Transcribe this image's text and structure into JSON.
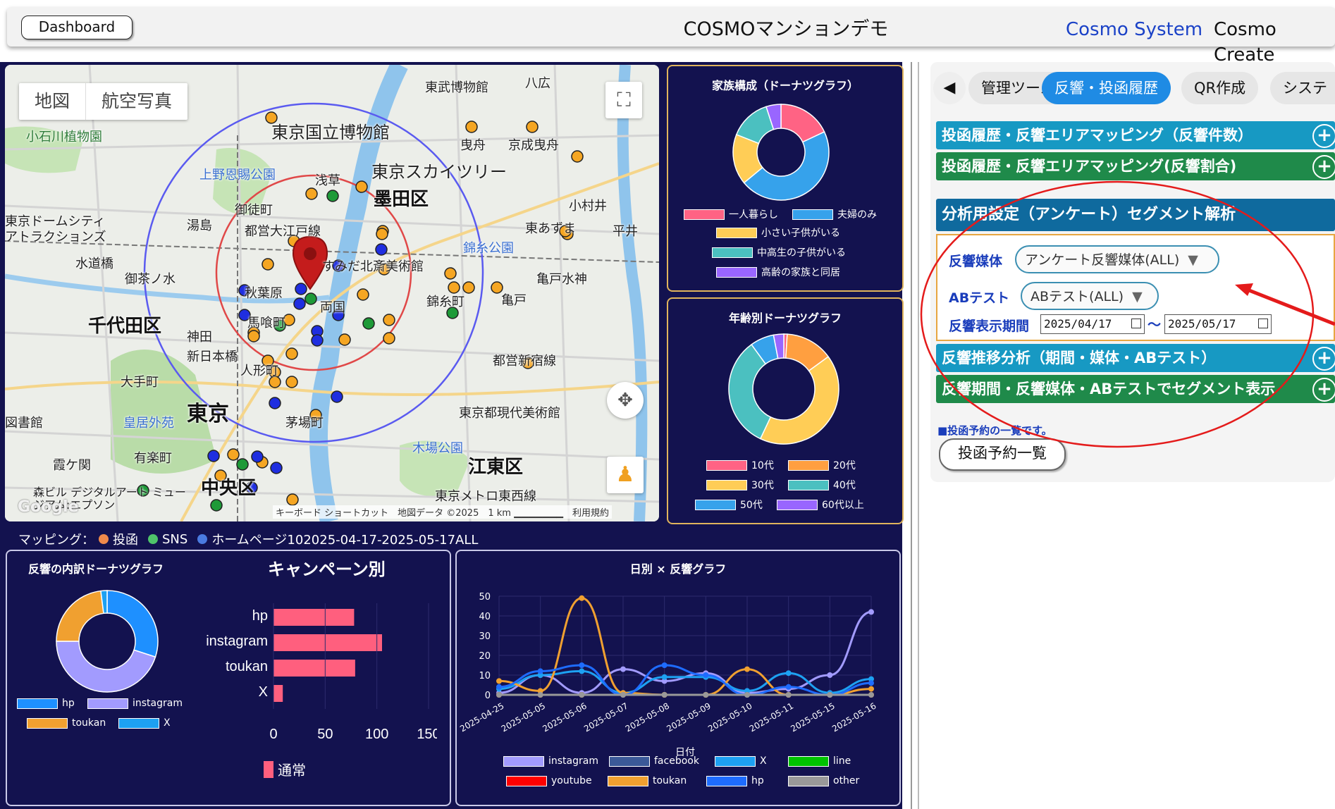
{
  "header": {
    "dashboard_button": "Dashboard",
    "app_title": "COSMOマンションデモ",
    "nav_system": "Cosmo System",
    "nav_create": "Cosmo Create"
  },
  "map": {
    "type_map": "地図",
    "type_satellite": "航空写真",
    "google": "Google",
    "footer": "キーボード ショートカット　地図データ ©2025　1 km ▁▁▁▁▁▁▁　利用規約",
    "labels": {
      "tokyo": "東京",
      "chiyoda": "千代田区",
      "sumida": "墨田区",
      "koto": "江東区",
      "chuo": "中央区",
      "akihabara": "秋葉原",
      "ryogoku": "両国",
      "asakusa": "浅草",
      "okachimachi": "御徒町",
      "yushima": "湯島",
      "ochanomizu": "御茶ノ水",
      "suidobashi": "水道橋",
      "kanda": "神田",
      "shinnihonbashi": "新日本橋",
      "otemachi": "大手町",
      "kayabacho": "茅場町",
      "yurakucho": "有楽町",
      "kasumigaseki": "霞ケ関",
      "kinshicho": "錦糸町",
      "kameido": "亀戸",
      "oshiage": "曳舟",
      "higashiazuma": "東あずま",
      "hirai": "平井",
      "komatsugawa": "小村井",
      "kameidosuijin": "亀戸水神",
      "bakuro": "馬喰町",
      "ningyocho": "人形町",
      "museum_national": "東京国立博物館",
      "museum_tokyo": "東武博物館",
      "museum_contemporary": "東京都現代美術館",
      "museum_hokusai": "すみだ北斎美術館",
      "skytree": "東京スカイツリー",
      "ueno_park": "上野恩賜公園",
      "kinshi_park": "錦糸公園",
      "kiba_park": "木場公園",
      "koishikawa": "小石川植物園",
      "dome_city": "東京ドームシティ アトラクションズ",
      "imperial": "皇居外苑",
      "keisei": "京成曳舟",
      "yahiro": "八広",
      "tokyo_dome_line": "都営新宿線",
      "toedaiedo": "都営大江戸線",
      "tozai": "東京メトロ東西線",
      "kyoshobo": "図書館",
      "mori": "森ビル デジタルアート ミュージアム:エプソン"
    }
  },
  "mapping_legend": {
    "prefix": "マッピング：",
    "items": [
      {
        "label": "投函",
        "color": "#f08a4b"
      },
      {
        "label": "SNS",
        "color": "#4fc46a"
      },
      {
        "label": "ホームページ102025-04-17-2025-05-17ALL",
        "color": "#4a7be0"
      }
    ]
  },
  "family_chart": {
    "title": "家族構成（ドーナツグラフ）",
    "legend": [
      {
        "label": "一人暮らし",
        "color": "#ff6384"
      },
      {
        "label": "夫婦のみ",
        "color": "#36a2eb"
      },
      {
        "label": "小さい子供がいる",
        "color": "#ffcd56"
      },
      {
        "label": "中高生の子供がいる",
        "color": "#4bc0c0"
      },
      {
        "label": "高齢の家族と同居",
        "color": "#9966ff"
      }
    ],
    "values": [
      18,
      46,
      17,
      14,
      5
    ]
  },
  "age_chart": {
    "title": "年齢別ドーナツグラフ",
    "legend": [
      {
        "label": "10代",
        "color": "#ff6384"
      },
      {
        "label": "20代",
        "color": "#ff9f40"
      },
      {
        "label": "30代",
        "color": "#ffcd56"
      },
      {
        "label": "40代",
        "color": "#4bc0c0"
      },
      {
        "label": "50代",
        "color": "#36a2eb"
      },
      {
        "label": "60代以上",
        "color": "#9966ff"
      }
    ],
    "values": [
      1,
      14,
      42,
      33,
      7,
      3
    ]
  },
  "response_chart": {
    "title": "反響の内訳ドーナツグラフ",
    "legend": [
      {
        "label": "hp",
        "color": "#1e90ff"
      },
      {
        "label": "instagram",
        "color": "#a29bfe"
      },
      {
        "label": "toukan",
        "color": "#f0a030"
      },
      {
        "label": "X",
        "color": "#1da1f2"
      }
    ],
    "values": [
      30,
      45,
      23,
      2
    ]
  },
  "campaign_chart": {
    "title": "キャンペーン別",
    "legend_label": "通常",
    "legend_color": "#ff5f7e"
  },
  "daily_chart": {
    "title": "日別 × 反響グラフ",
    "xlabel": "日付",
    "legend": [
      {
        "label": "instagram",
        "color": "#a29bfe"
      },
      {
        "label": "facebook",
        "color": "#3b5998"
      },
      {
        "label": "X",
        "color": "#1da1f2"
      },
      {
        "label": "line",
        "color": "#00c300"
      },
      {
        "label": "youtube",
        "color": "#ff0000"
      },
      {
        "label": "toukan",
        "color": "#f0a030"
      },
      {
        "label": "hp",
        "color": "#1e6cff"
      },
      {
        "label": "other",
        "color": "#999999"
      }
    ]
  },
  "chart_data": [
    {
      "type": "bar",
      "title": "キャンペーン別",
      "orientation": "horizontal",
      "categories": [
        "hp",
        "instagram",
        "toukan",
        "X"
      ],
      "series": [
        {
          "name": "通常",
          "values": [
            78,
            105,
            79,
            9
          ]
        }
      ],
      "xlim": [
        0,
        150
      ],
      "xticks": [
        0,
        50,
        100,
        150
      ]
    },
    {
      "type": "line",
      "title": "日別 × 反響グラフ",
      "xlabel": "日付",
      "categories": [
        "2025-04-25",
        "2025-05-05",
        "2025-05-06",
        "2025-05-07",
        "2025-05-08",
        "2025-05-09",
        "2025-05-10",
        "2025-05-11",
        "2025-05-15",
        "2025-05-16"
      ],
      "ylim": [
        0,
        50
      ],
      "yticks": [
        0,
        10,
        20,
        30,
        40,
        50
      ],
      "series": [
        {
          "name": "instagram",
          "color": "#a29bfe",
          "values": [
            1,
            10,
            1,
            13,
            7,
            11,
            1,
            3,
            10,
            42
          ]
        },
        {
          "name": "facebook",
          "color": "#3b5998",
          "values": [
            0,
            0,
            0,
            0,
            0,
            0,
            0,
            0,
            0,
            0
          ]
        },
        {
          "name": "X",
          "color": "#1da1f2",
          "values": [
            3,
            10,
            12,
            1,
            9,
            9,
            2,
            11,
            1,
            8
          ]
        },
        {
          "name": "line",
          "color": "#00c300",
          "values": [
            0,
            0,
            0,
            0,
            0,
            0,
            0,
            0,
            0,
            0
          ]
        },
        {
          "name": "youtube",
          "color": "#ff0000",
          "values": [
            0,
            0,
            0,
            0,
            0,
            0,
            0,
            0,
            0,
            0
          ]
        },
        {
          "name": "toukan",
          "color": "#f0a030",
          "values": [
            7,
            2,
            49,
            1,
            0,
            0,
            13,
            0,
            0,
            3
          ]
        },
        {
          "name": "hp",
          "color": "#1e6cff",
          "values": [
            4,
            12,
            15,
            0,
            15,
            10,
            0,
            4,
            0,
            6
          ]
        },
        {
          "name": "other",
          "color": "#999999",
          "values": [
            0,
            0,
            0,
            0,
            0,
            0,
            0,
            0,
            0,
            0
          ]
        }
      ]
    }
  ],
  "right_panel": {
    "tabs": [
      {
        "label": "管理ツール",
        "active": false
      },
      {
        "label": "反響・投函履歴",
        "active": true
      },
      {
        "label": "QR作成",
        "active": false
      },
      {
        "label": "システ",
        "active": false
      }
    ],
    "accordions": {
      "mapping_count": "投函履歴・反響エリアマッピング（反響件数）",
      "mapping_ratio": "投函履歴・反響エリアマッピング(反響割合)",
      "segment": "分析用設定（アンケート）セグメント解析",
      "trend": "反響推移分析（期間・媒体・ABテスト）",
      "period_segment": "反響期間・反響媒体・ABテストでセグメント表示"
    },
    "fields": {
      "media_label": "反響媒体",
      "media_value": "アンケート反響媒体(ALL)",
      "ab_label": "ABテスト",
      "ab_value": "ABテスト(ALL)",
      "period_label": "反響表示期間",
      "date_from": "2025/04/17",
      "date_to": "2025/05/17",
      "tilde": "〜"
    },
    "note": "■投函予約の一覧です。",
    "list_button": "投函予約一覧"
  }
}
